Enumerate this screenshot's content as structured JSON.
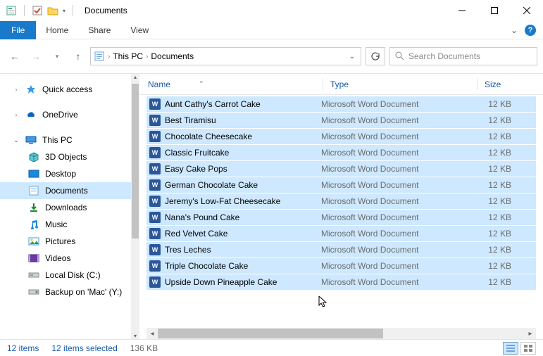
{
  "title": "Documents",
  "ribbon": {
    "file": "File",
    "tabs": [
      "Home",
      "Share",
      "View"
    ]
  },
  "breadcrumbs": [
    "This PC",
    "Documents"
  ],
  "search": {
    "placeholder": "Search Documents"
  },
  "sidebar": {
    "quick_access": "Quick access",
    "onedrive": "OneDrive",
    "this_pc": "This PC",
    "items": [
      {
        "label": "3D Objects",
        "key": "3d"
      },
      {
        "label": "Desktop",
        "key": "desktop"
      },
      {
        "label": "Documents",
        "key": "documents",
        "selected": true
      },
      {
        "label": "Downloads",
        "key": "downloads"
      },
      {
        "label": "Music",
        "key": "music"
      },
      {
        "label": "Pictures",
        "key": "pictures"
      },
      {
        "label": "Videos",
        "key": "videos"
      },
      {
        "label": "Local Disk (C:)",
        "key": "cdrive"
      },
      {
        "label": "Backup on 'Mac' (Y:)",
        "key": "ydrive"
      }
    ]
  },
  "columns": {
    "name": "Name",
    "type": "Type",
    "size": "Size"
  },
  "files": [
    {
      "name": "Aunt Cathy's Carrot Cake",
      "type": "Microsoft Word Document",
      "size": "12 KB"
    },
    {
      "name": "Best Tiramisu",
      "type": "Microsoft Word Document",
      "size": "12 KB"
    },
    {
      "name": "Chocolate Cheesecake",
      "type": "Microsoft Word Document",
      "size": "12 KB"
    },
    {
      "name": "Classic Fruitcake",
      "type": "Microsoft Word Document",
      "size": "12 KB"
    },
    {
      "name": "Easy Cake Pops",
      "type": "Microsoft Word Document",
      "size": "12 KB"
    },
    {
      "name": "German Chocolate Cake",
      "type": "Microsoft Word Document",
      "size": "12 KB"
    },
    {
      "name": "Jeremy's Low-Fat Cheesecake",
      "type": "Microsoft Word Document",
      "size": "12 KB"
    },
    {
      "name": "Nana's Pound Cake",
      "type": "Microsoft Word Document",
      "size": "12 KB"
    },
    {
      "name": "Red Velvet Cake",
      "type": "Microsoft Word Document",
      "size": "12 KB"
    },
    {
      "name": "Tres Leches",
      "type": "Microsoft Word Document",
      "size": "12 KB"
    },
    {
      "name": "Triple Chocolate Cake",
      "type": "Microsoft Word Document",
      "size": "12 KB"
    },
    {
      "name": "Upside Down Pineapple Cake",
      "type": "Microsoft Word Document",
      "size": "12 KB"
    }
  ],
  "status": {
    "count": "12 items",
    "selected": "12 items selected",
    "size": "136 KB"
  }
}
